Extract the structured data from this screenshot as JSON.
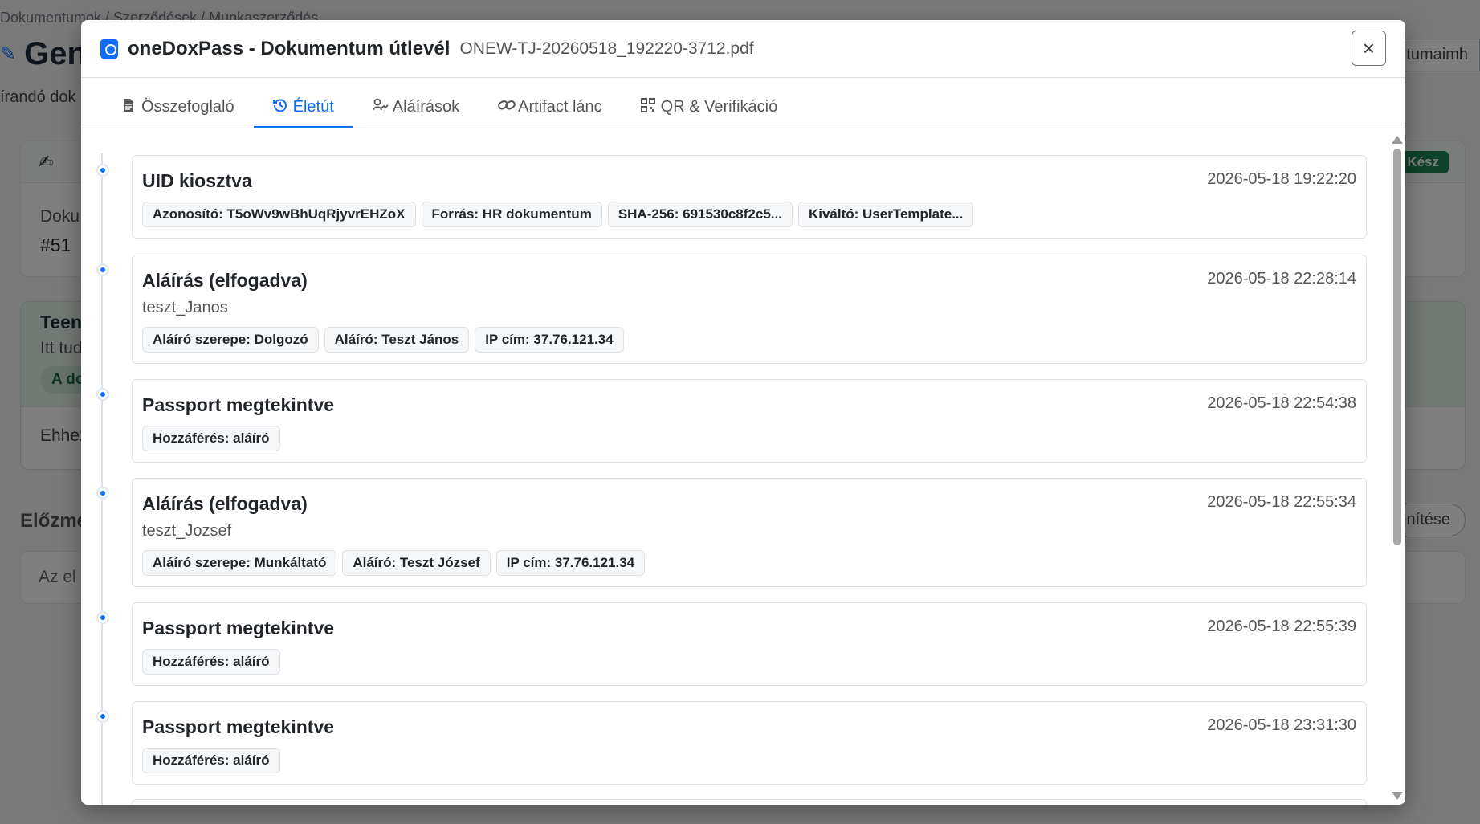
{
  "background": {
    "breadcrumb": "Dokumentumok / Szerződések / Munkaszerződés",
    "title": "Gen",
    "subtitle": "írandó dok",
    "right_button": "ntumaimh",
    "card1_label": "Doku",
    "card1_number": "#51",
    "status_badge": "Kész",
    "card2_title": "Teen",
    "card2_text": "Itt tud",
    "card2_pill": "A do",
    "card2_footer": "Ehhez",
    "history_title": "Előzmé",
    "history_button": "enítése",
    "card3_text": "Az el"
  },
  "modal": {
    "title": "oneDoxPass - Dokumentum útlevél",
    "filename": "ONEW-TJ-20260518_192220-3712.pdf",
    "close_label": "×",
    "tabs": [
      {
        "label": "Összefoglaló",
        "icon": "file-icon"
      },
      {
        "label": "Életút",
        "icon": "history-icon"
      },
      {
        "label": "Aláírások",
        "icon": "signature-icon"
      },
      {
        "label": "Artifact lánc",
        "icon": "link-icon"
      },
      {
        "label": "QR & Verifikáció",
        "icon": "qr-icon"
      }
    ],
    "active_tab": "Életút"
  },
  "timeline": [
    {
      "title": "UID kiosztva",
      "time": "2026-05-18 19:22:20",
      "user": "",
      "tags": [
        "Azonosító: T5oWv9wBhUqRjyvrEHZoX",
        "Forrás: HR dokumentum",
        "SHA-256: 691530c8f2c5...",
        "Kiváltó: UserTemplate..."
      ]
    },
    {
      "title": "Aláírás (elfogadva)",
      "time": "2026-05-18 22:28:14",
      "user": "teszt_Janos",
      "tags": [
        "Aláíró szerepe: Dolgozó",
        "Aláíró: Teszt János",
        "IP cím: 37.76.121.34"
      ]
    },
    {
      "title": "Passport megtekintve",
      "time": "2026-05-18 22:54:38",
      "user": "",
      "tags": [
        "Hozzáférés: aláíró"
      ]
    },
    {
      "title": "Aláírás (elfogadva)",
      "time": "2026-05-18 22:55:34",
      "user": "teszt_Jozsef",
      "tags": [
        "Aláíró szerepe: Munkáltató",
        "Aláíró: Teszt József",
        "IP cím: 37.76.121.34"
      ]
    },
    {
      "title": "Passport megtekintve",
      "time": "2026-05-18 22:55:39",
      "user": "",
      "tags": [
        "Hozzáférés: aláíró"
      ]
    },
    {
      "title": "Passport megtekintve",
      "time": "2026-05-18 23:31:30",
      "user": "",
      "tags": [
        "Hozzáférés: aláíró"
      ]
    }
  ],
  "colors": {
    "accent": "#0d6efd",
    "success": "#198754"
  }
}
